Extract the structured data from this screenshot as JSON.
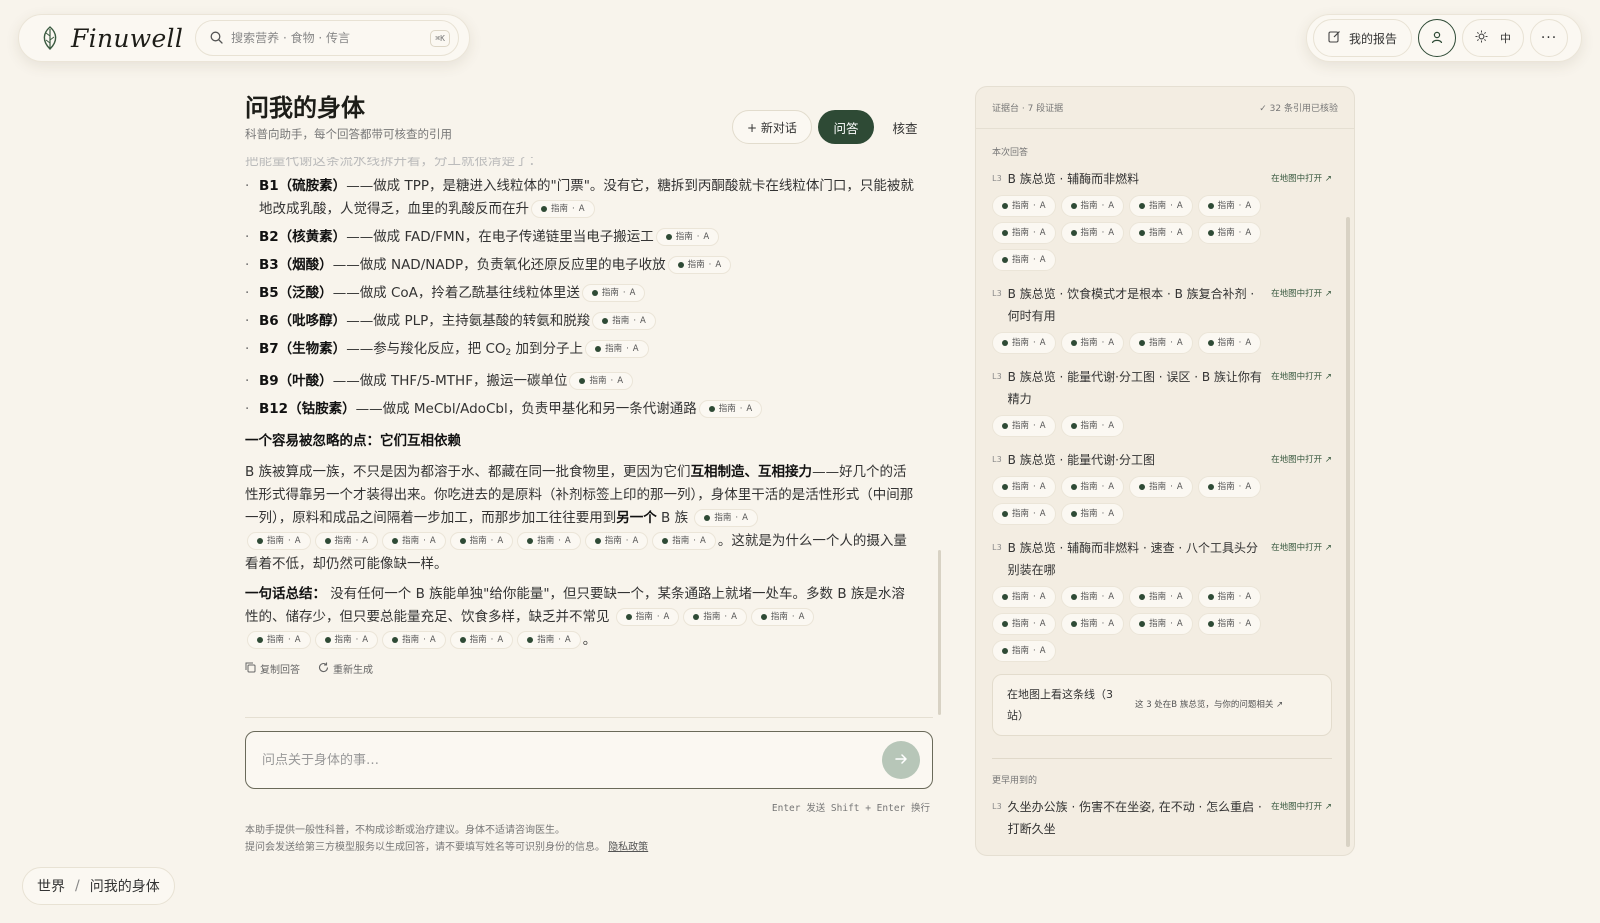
{
  "brand": {
    "name": "Finuwell"
  },
  "search": {
    "placeholder": "搜索营养 · 食物 · 传言",
    "shortcut": "⌘K"
  },
  "header": {
    "report_label": "我的报告",
    "lang_label": "中",
    "more_label": "···"
  },
  "page": {
    "title": "问我的身体",
    "subtitle": "科普向助手，每个回答都带可核查的引用"
  },
  "tabs": {
    "new_chat": "+ 新对话",
    "ask": "问答",
    "verify": "核查"
  },
  "chat": {
    "faded_line": "把能量代谢这条流水线拆开看，分工就很清楚了：",
    "vitamins": [
      {
        "name": "B1（硫胺素）",
        "desc": "——做成 TPP，是糖进入线粒体的\"门票\"。没有它，糖拆到丙酮酸就卡在线粒体门口，只能被就地改成乳酸，人觉得乏，血里的乳酸反而在升"
      },
      {
        "name": "B2（核黄素）",
        "desc": "——做成 FAD/FMN，在电子传递链里当电子搬运工"
      },
      {
        "name": "B3（烟酸）",
        "desc": "——做成 NAD/NADP，负责氧化还原反应里的电子收放"
      },
      {
        "name": "B5（泛酸）",
        "desc": "——做成 CoA，拎着乙酰基往线粒体里送"
      },
      {
        "name": "B6（吡哆醇）",
        "desc": "——做成 PLP，主持氨基酸的转氨和脱羧"
      },
      {
        "name": "B7（生物素）",
        "desc": "——参与羧化反应，把 CO",
        "desc_sub": "2",
        "desc_tail": " 加到分子上"
      },
      {
        "name": "B9（叶酸）",
        "desc": "——做成 THF/5-MTHF，搬运一碳单位"
      },
      {
        "name": "B12（钴胺素）",
        "desc": "——做成 MeCbl/AdoCbl，负责甲基化和另一条代谢通路"
      }
    ],
    "pill_source": "指南",
    "pill_grade": "A",
    "heading": "一个容易被忽略的点：它们互相依赖",
    "para1_a": "B 族被算成一族，不只是因为都溶于水、都藏在同一批食物里，更因为它们",
    "para1_b": "互相制造、互相接力",
    "para1_c": "——好几个的活性形式得靠另一个才装得出来。你吃进去的是原料（补剂标签上印的那一列），身体里干活的是活性形式（中间那一列），原料和成品之间隔着一步加工，而那步加工往往要用到",
    "para1_d": "另一个",
    "para1_e": " B 族",
    "para1_f": "。这就是为什么一个人的摄入量看着不低，却仍然可能像缺一样。",
    "summary_label": "一句话总结：",
    "summary_a": " 没有任何一个 B 族能单独\"给你能量\"，但只要缺一个，某条通路上就堵一处车。多数 B 族是水溶性的、储存少，但只要总能量充足、饮食多样，缺乏并不常见",
    "summary_end": "。",
    "copy_label": "复制回答",
    "regen_label": "重新生成"
  },
  "composer": {
    "placeholder": "问点关于身体的事…",
    "hint": "Enter 发送   Shift + Enter 换行"
  },
  "disclaimer": {
    "line1": "本助手提供一般性科普，不构成诊断或治疗建议。身体不适请咨询医生。",
    "line2": "提问会发送给第三方模型服务以生成回答，请不要填写姓名等可识别身份的信息。",
    "privacy_link": "隐私政策"
  },
  "breadcrumb": {
    "root": "世界",
    "sep": "/",
    "current": "问我的身体"
  },
  "evidence": {
    "header_left": "证据台  ·  7  段证据",
    "header_right": "✓ 32 条引用已核验",
    "section_current": "本次回答",
    "open_label": "在地图中打开 ↗",
    "level": "L3",
    "items": [
      {
        "title": "B 族总览 · 辅酶而非燃料",
        "pills": 9
      },
      {
        "title": "B 族总览 · 饮食模式才是根本 · B 族复合补剂 · 何时有用",
        "pills": 4
      },
      {
        "title": "B 族总览 · 能量代谢·分工图 · 误区 · B 族让你有精力",
        "pills": 2
      },
      {
        "title": "B 族总览 · 能量代谢·分工图",
        "pills": 6
      },
      {
        "title": "B 族总览 · 辅酶而非燃料 · 速查 · 八个工具头分别装在哪",
        "pills": 9
      }
    ],
    "map_card_title": "在地图上看这条线（3 站）",
    "map_card_desc": "这 3 处在B 族总览，与你的问题相关 ↗",
    "section_earlier": "更早用到的",
    "earlier_item": {
      "title": "久坐办公族 · 伤害不在坐姿, 在不动 · 怎么重启 · 打断久坐"
    }
  },
  "colors": {
    "accent": "#2e4a35",
    "background": "#f8f4ec",
    "panel": "#f3ede2"
  }
}
